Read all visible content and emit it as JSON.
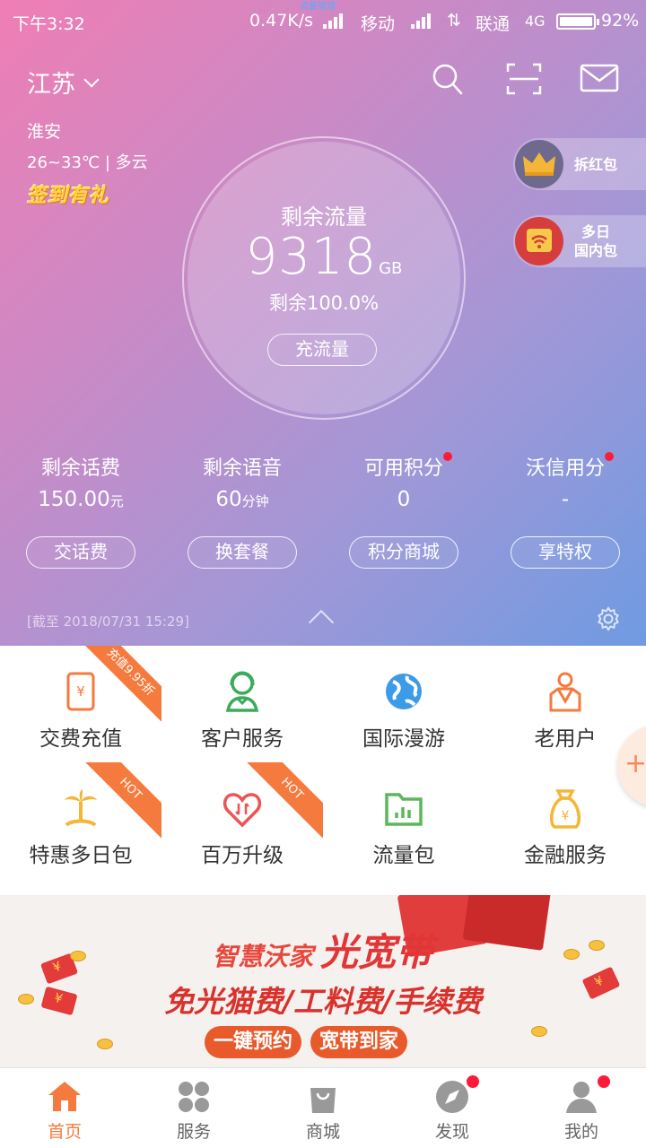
{
  "status_bar": {
    "time": "下午3:32",
    "speed": "0.47K/s",
    "tiny_text": "流量管理",
    "carrier1": "移动",
    "carrier2": "联通",
    "network": "4G",
    "battery": "92%"
  },
  "header": {
    "region": "江苏",
    "icons": [
      "search-icon",
      "scan-icon",
      "mail-icon"
    ],
    "weather_city": "淮安",
    "weather_info": "26~33℃ | 多云",
    "checkin": "签到有礼"
  },
  "data_ring": {
    "label": "剩余流量",
    "value": "9318",
    "unit": "GB",
    "percent_text": "剩余100.0%",
    "button": "充流量"
  },
  "side_pills": [
    {
      "label": "拆红包",
      "icon": "crown-icon"
    },
    {
      "label_line1": "多日",
      "label_line2": "国内包",
      "icon": "wifi-badge-icon"
    }
  ],
  "stats": [
    {
      "label": "剩余话费",
      "value": "150.00",
      "unit": "元",
      "dot": false
    },
    {
      "label": "剩余语音",
      "value": "60",
      "unit": "分钟",
      "dot": false
    },
    {
      "label": "可用积分",
      "value": "0",
      "unit": "",
      "dot": true
    },
    {
      "label": "沃信用分",
      "value": "-",
      "unit": "",
      "dot": true
    }
  ],
  "actions": [
    "交话费",
    "换套餐",
    "积分商城",
    "享特权"
  ],
  "as_of": "[截至 2018/07/31 15:29]",
  "grid": [
    {
      "label": "交费充值",
      "icon": "phone-yen-icon",
      "ribbon": "充值9.95折"
    },
    {
      "label": "客户服务",
      "icon": "customer-service-icon",
      "ribbon": ""
    },
    {
      "label": "国际漫游",
      "icon": "globe-icon",
      "ribbon": ""
    },
    {
      "label": "老用户",
      "icon": "user-badge-icon",
      "ribbon": ""
    },
    {
      "label": "特惠多日包",
      "icon": "palm-tree-icon",
      "ribbon": "HOT"
    },
    {
      "label": "百万升级",
      "icon": "heart-arrows-icon",
      "ribbon": "HOT"
    },
    {
      "label": "流量包",
      "icon": "folder-chart-icon",
      "ribbon": ""
    },
    {
      "label": "金融服务",
      "icon": "money-bag-icon",
      "ribbon": ""
    }
  ],
  "banner": {
    "line1a": "智慧沃家",
    "line1b": "光宽带",
    "line2": "免光猫费/工料费/手续费",
    "cta1": "一键预约",
    "cta2": "宽带到家"
  },
  "tabs": [
    {
      "label": "首页",
      "icon": "home-icon",
      "active": true,
      "dot": false
    },
    {
      "label": "服务",
      "icon": "grid-icon",
      "active": false,
      "dot": false
    },
    {
      "label": "商城",
      "icon": "bag-icon",
      "active": false,
      "dot": false
    },
    {
      "label": "发现",
      "icon": "compass-icon",
      "active": false,
      "dot": true
    },
    {
      "label": "我的",
      "icon": "person-icon",
      "active": false,
      "dot": true
    }
  ],
  "colors": {
    "accent": "#f57a3e",
    "red_dot": "#ff1a3a"
  }
}
